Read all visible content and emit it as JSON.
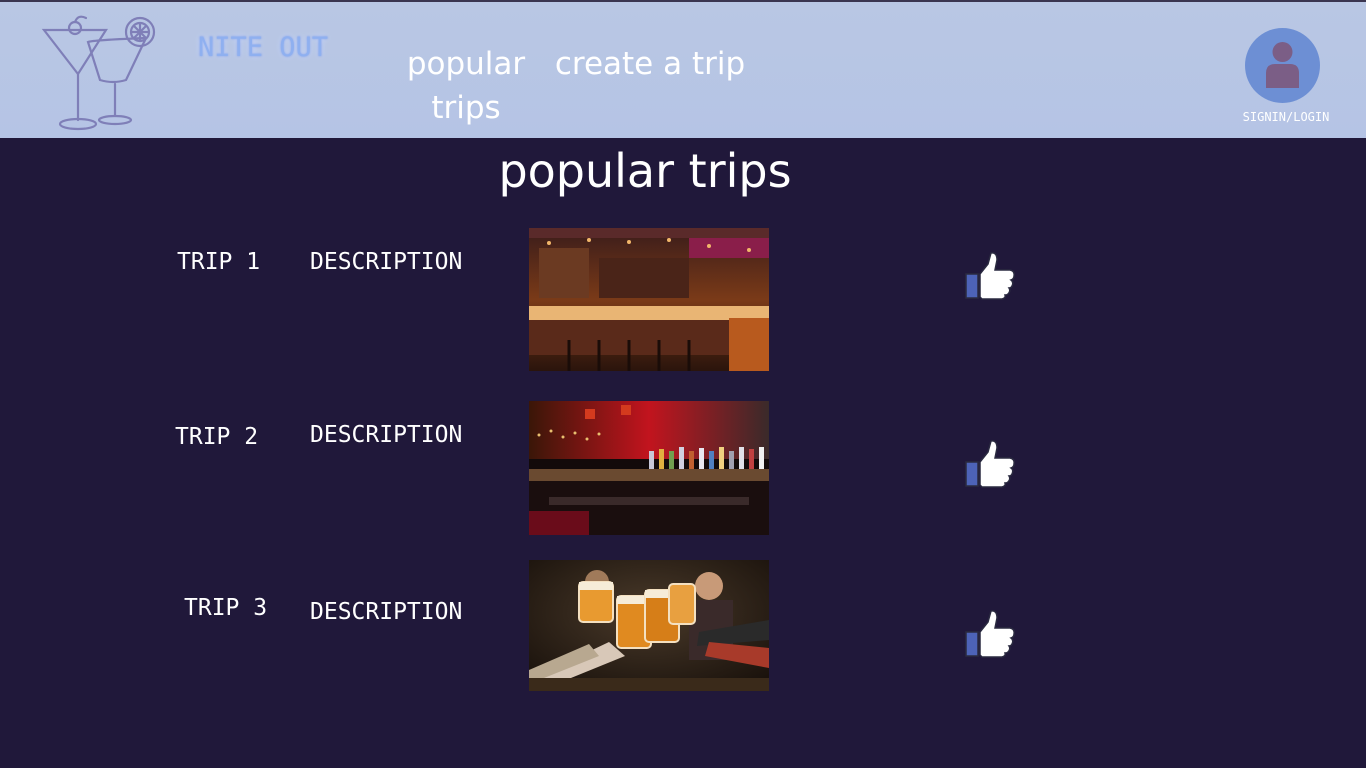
{
  "header": {
    "brand": "NITE OUT",
    "nav": [
      {
        "label": "popular trips"
      },
      {
        "label": "create a trip"
      }
    ],
    "signin_label": "SIGNIN/LOGIN"
  },
  "main": {
    "title": "popular trips",
    "trips": [
      {
        "label": "TRIP 1",
        "description": "DESCRIPTION"
      },
      {
        "label": "TRIP 2",
        "description": "DESCRIPTION"
      },
      {
        "label": "TRIP 3",
        "description": "DESCRIPTION"
      }
    ]
  },
  "colors": {
    "header_bg": "#b9c7e4",
    "page_bg": "#20183a",
    "brand_glow": "#8fb0f0",
    "avatar_bg": "#6d8fd4",
    "like_blue": "#4d63b7"
  },
  "icons": {
    "logo": "cocktail-glasses-icon",
    "avatar": "user-icon",
    "like": "thumbs-up-icon"
  }
}
